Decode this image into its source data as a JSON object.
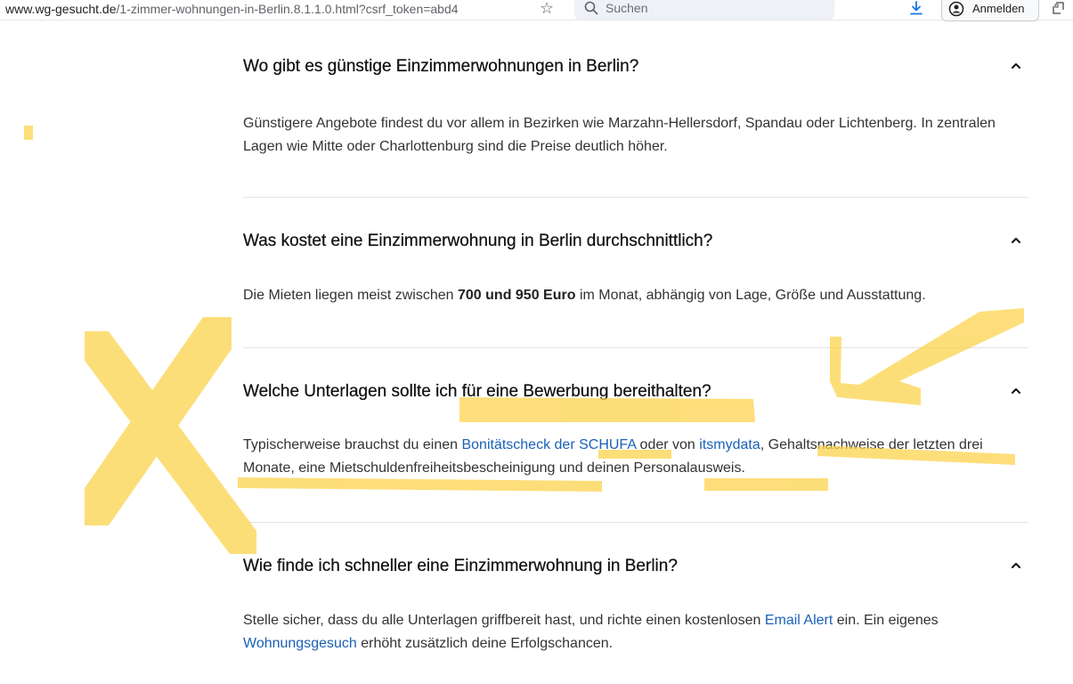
{
  "browser": {
    "url_domain": "www.wg-gesucht.de",
    "url_path": "/1-zimmer-wohnungen-in-Berlin.8.1.1.0.html?csrf_token=abd4",
    "search_placeholder": "Suchen",
    "signin_label": "Anmelden"
  },
  "faq": [
    {
      "question": "Wo gibt es günstige Einzimmerwohnungen in Berlin?",
      "answer": "Günstigere Angebote findest du vor allem in Bezirken wie Marzahn-Hellersdorf, Spandau oder Lichtenberg. In zentralen Lagen wie Mitte oder Charlottenburg sind die Preise deutlich höher."
    },
    {
      "question": "Was kostet eine Einzimmerwohnung in Berlin durchschnittlich?",
      "answer_pre": "Die Mieten liegen meist zwischen ",
      "answer_bold": "700 und 950 Euro",
      "answer_post": " im Monat, abhängig von Lage, Größe und Ausstattung."
    },
    {
      "question": "Welche Unterlagen sollte ich für eine Bewerbung bereithalten?",
      "answer_pre": "Typischerweise brauchst du einen ",
      "link1": "Bonitätscheck der SCHUFA",
      "answer_mid": " oder von ",
      "link2": "itsmydata",
      "answer_post": ", Gehaltsnachweise der letzten drei Monate, eine Mietschuldenfreiheitsbescheinigung und deinen Personalausweis."
    },
    {
      "question": "Wie finde ich schneller eine Einzimmerwohnung in Berlin?",
      "answer_pre": "Stelle sicher, dass du alle Unterlagen griffbereit hast, und richte einen kostenlosen ",
      "link1": "Email Alert",
      "answer_mid": " ein. Ein eigenes ",
      "link2": "Wohnungsgesuch",
      "answer_post": " erhöht zusätzlich deine Erfolgschancen."
    }
  ],
  "colors": {
    "link": "#1a61b6",
    "highlighter": "#fcd34d",
    "separator": "#e3e3e3"
  },
  "icons": [
    "star-icon",
    "search-icon",
    "download-icon",
    "account-icon",
    "extensions-icon",
    "chevron-up-icon"
  ]
}
